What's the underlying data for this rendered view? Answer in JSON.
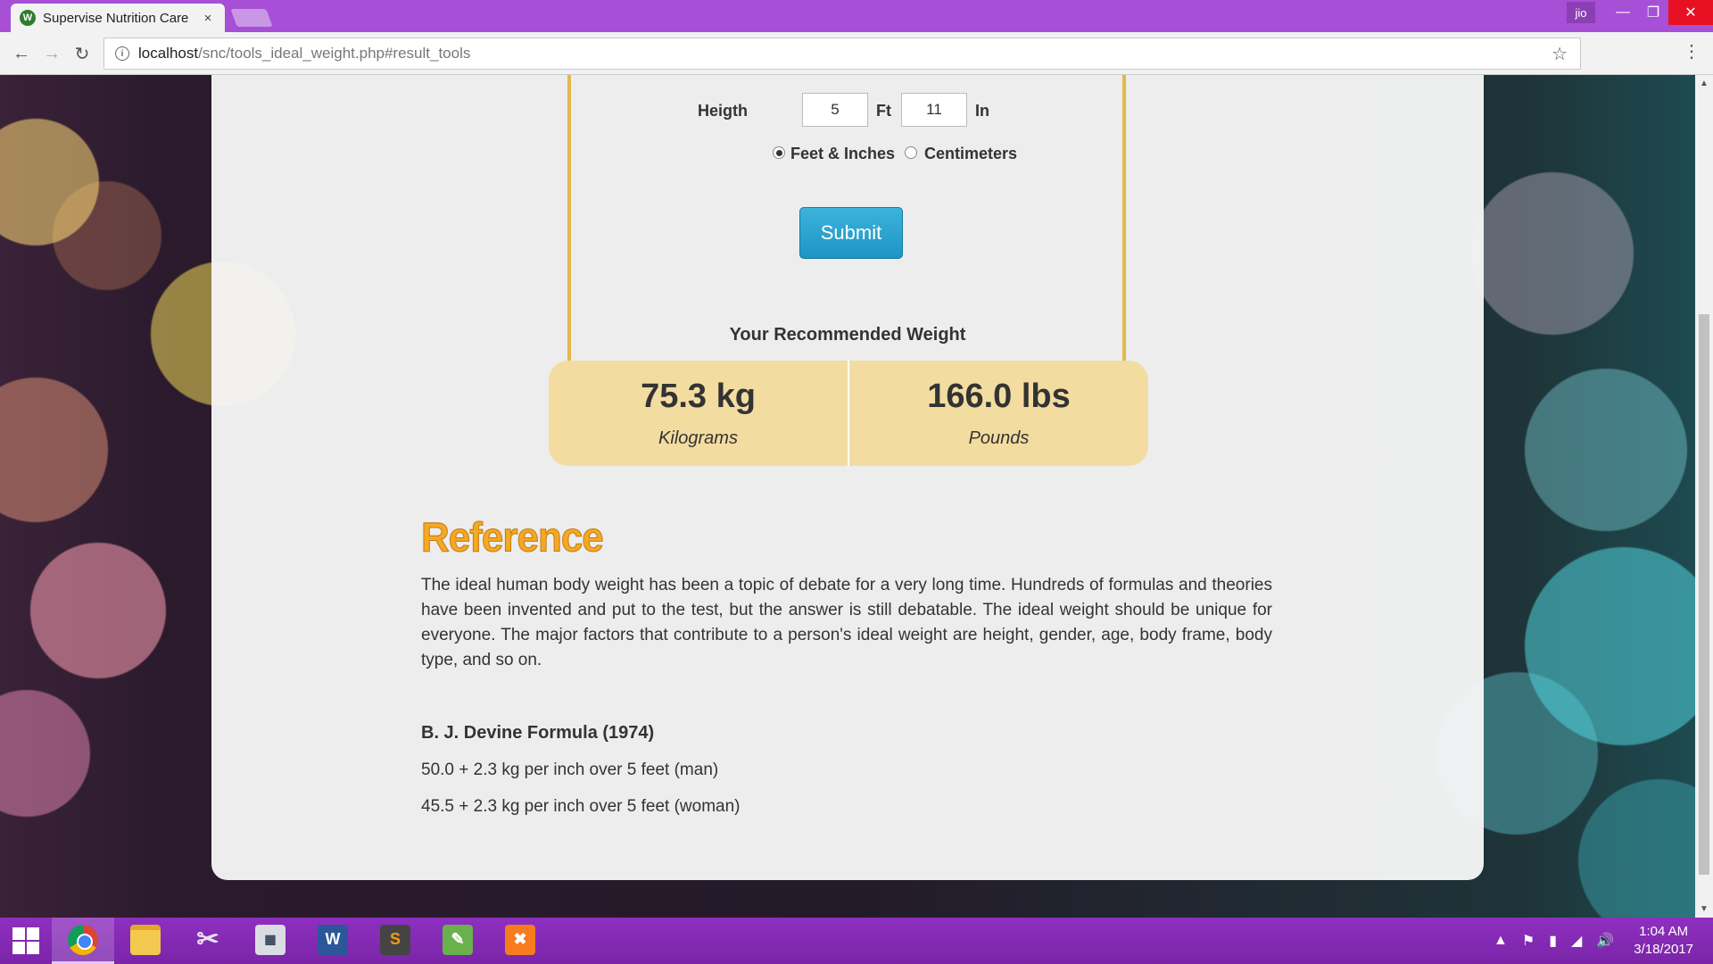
{
  "browser": {
    "tab_title": "Supervise Nutrition Care",
    "tab_close": "×",
    "url_host": "localhost",
    "url_path": "/snc/tools_ideal_weight.php#result_tools",
    "profile": "jio"
  },
  "form": {
    "height_label": "Heigth",
    "feet_value": "5",
    "feet_unit": "Ft",
    "inches_value": "11",
    "inches_unit": "In",
    "radio_feet_label": "Feet & Inches",
    "radio_cm_label": "Centimeters",
    "selected_unit": "Feet & Inches",
    "submit_label": "Submit"
  },
  "result": {
    "title": "Your Recommended Weight",
    "kg_value": "75.3 kg",
    "kg_label": "Kilograms",
    "lbs_value": "166.0 lbs",
    "lbs_label": "Pounds"
  },
  "reference": {
    "heading": "Reference",
    "paragraph": "The ideal human body weight has been a topic of debate for a very long time. Hundreds of formulas and theories have been invented and put to the test, but the answer is still debatable. The ideal weight should be unique for everyone. The major factors that contribute to a person's ideal weight are height, gender, age, body frame, body type, and so on.",
    "formula_title": "B. J. Devine Formula (1974)",
    "formula_man": "50.0 + 2.3 kg per inch over 5 feet (man)",
    "formula_woman": "45.5 + 2.3 kg per inch over 5 feet (woman)"
  },
  "taskbar": {
    "apps": [
      "chrome-icon",
      "file-explorer-icon",
      "snipping-tool-icon",
      "calculator-icon",
      "word-icon",
      "sublime-text-icon",
      "notepad-icon",
      "xampp-icon"
    ],
    "time": "1:04 AM",
    "date": "3/18/2017"
  },
  "colors": {
    "titlebar": "#a74fd6",
    "form_border": "#e6b84a",
    "result_bg": "#f3dca0",
    "submit_bg": "#2aa3d1",
    "reference_heading": "#f5a823"
  }
}
